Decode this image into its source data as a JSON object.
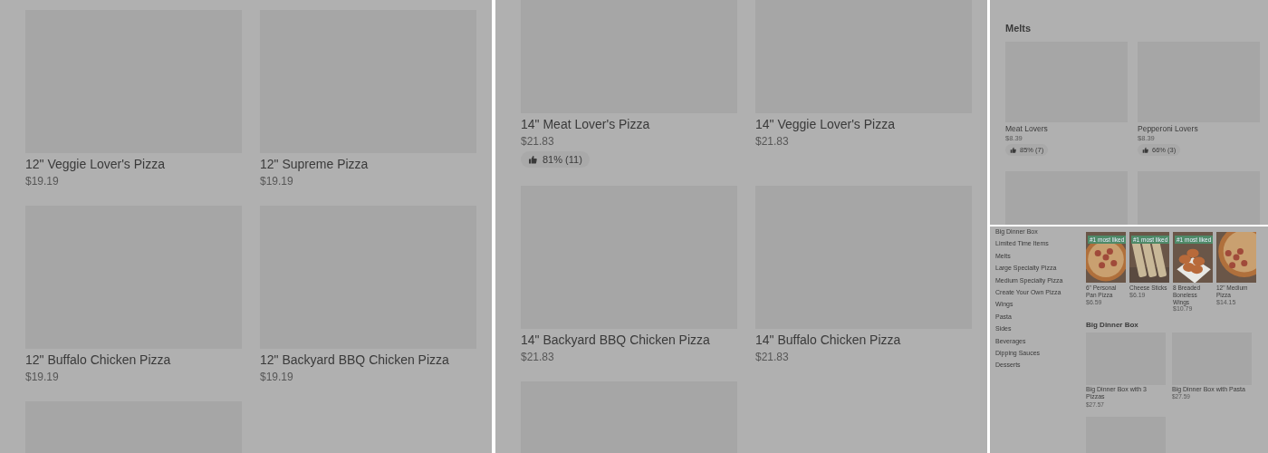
{
  "panels": [
    {
      "kind": "large",
      "cards": [
        {
          "kind": "item",
          "name": "12\" Veggie Lover's Pizza",
          "price": "$19.19"
        },
        {
          "kind": "item",
          "name": "12\" Supreme Pizza",
          "price": "$19.19"
        },
        {
          "kind": "item",
          "name": "12\" Buffalo Chicken Pizza",
          "price": "$19.19"
        },
        {
          "kind": "item",
          "name": "12\" Backyard BBQ Chicken Pizza",
          "price": "$19.19"
        },
        {
          "kind": "image_only"
        }
      ]
    },
    {
      "kind": "large",
      "cards": [
        {
          "kind": "item",
          "name": "14\" Meat Lover's Pizza",
          "price": "$21.83",
          "rating": "81% (11)"
        },
        {
          "kind": "item",
          "name": "14\" Veggie Lover's Pizza",
          "price": "$21.83"
        },
        {
          "kind": "item",
          "name": "14\" Backyard BBQ Chicken Pizza",
          "price": "$21.83"
        },
        {
          "kind": "item",
          "name": "14\" Buffalo Chicken Pizza",
          "price": "$21.83"
        },
        {
          "kind": "image_only"
        }
      ]
    },
    {
      "kind": "small",
      "heading": "Melts",
      "cards": [
        {
          "kind": "item",
          "name": "Meat Lovers",
          "price": "$8.39",
          "rating": "85% (7)"
        },
        {
          "kind": "item",
          "name": "Pepperoni Lovers",
          "price": "$8.39",
          "rating": "66% (3)"
        },
        {
          "kind": "image_only"
        },
        {
          "kind": "image_only"
        }
      ]
    },
    {
      "kind": "page",
      "categories": [
        "Big Dinner Box",
        "Limited Time Items",
        "Melts",
        "Large Specialty Pizza",
        "Medium Specialty Pizza",
        "Create Your Own Pizza",
        "Wings",
        "Pasta",
        "Sides",
        "Beverages",
        "Dipping Sauces",
        "Desserts"
      ],
      "featured": [
        {
          "kind": "item",
          "name": "6\" Personal Pan Pizza",
          "price": "$6.59",
          "badge": "#1 most liked"
        },
        {
          "kind": "item",
          "name": "Cheese Sticks",
          "price": "$6.19",
          "badge": "#1 most liked"
        },
        {
          "kind": "item",
          "name": "8 Breaded Boneless Wings",
          "price": "$10.79",
          "badge": "#1 most liked"
        },
        {
          "kind": "item",
          "name": "12\" Medium Pizza",
          "price": "$14.15"
        }
      ],
      "heading": "Big Dinner Box",
      "cards": [
        {
          "kind": "item",
          "name": "Big Dinner Box with 3 Pizzas",
          "price": "$27.57"
        },
        {
          "kind": "item",
          "name": "Big Dinner Box with Pasta",
          "price": "$27.59"
        },
        {
          "kind": "image_only"
        }
      ]
    }
  ]
}
